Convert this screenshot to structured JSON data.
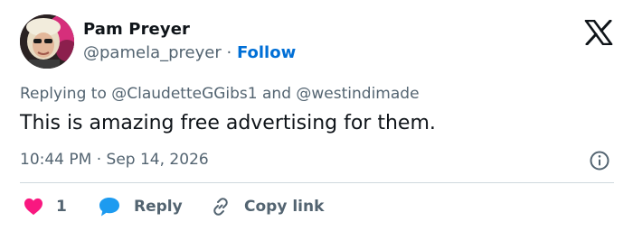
{
  "author": {
    "name": "Pam Preyer",
    "handle": "@pamela_preyer",
    "separator": "·",
    "follow_label": "Follow"
  },
  "replying": {
    "prefix": "Replying to",
    "mention_1": "@ClaudetteGGibs1",
    "conjunction": "and",
    "mention_2": "@westindimade"
  },
  "tweet": {
    "text": "This is amazing free advertising for them.",
    "time": "10:44 PM",
    "separator": "·",
    "date": "Sep 14, 2026"
  },
  "actions": {
    "like_count": "1",
    "reply_label": "Reply",
    "copy_label": "Copy link"
  },
  "colors": {
    "like": "#f91880",
    "reply": "#1d9bf0",
    "follow": "#006fd6",
    "muted": "#536471"
  },
  "icons": {
    "brand": "x-logo-icon",
    "info": "info-icon",
    "like": "heart-icon",
    "reply": "speech-bubble-icon",
    "copy": "link-icon"
  }
}
